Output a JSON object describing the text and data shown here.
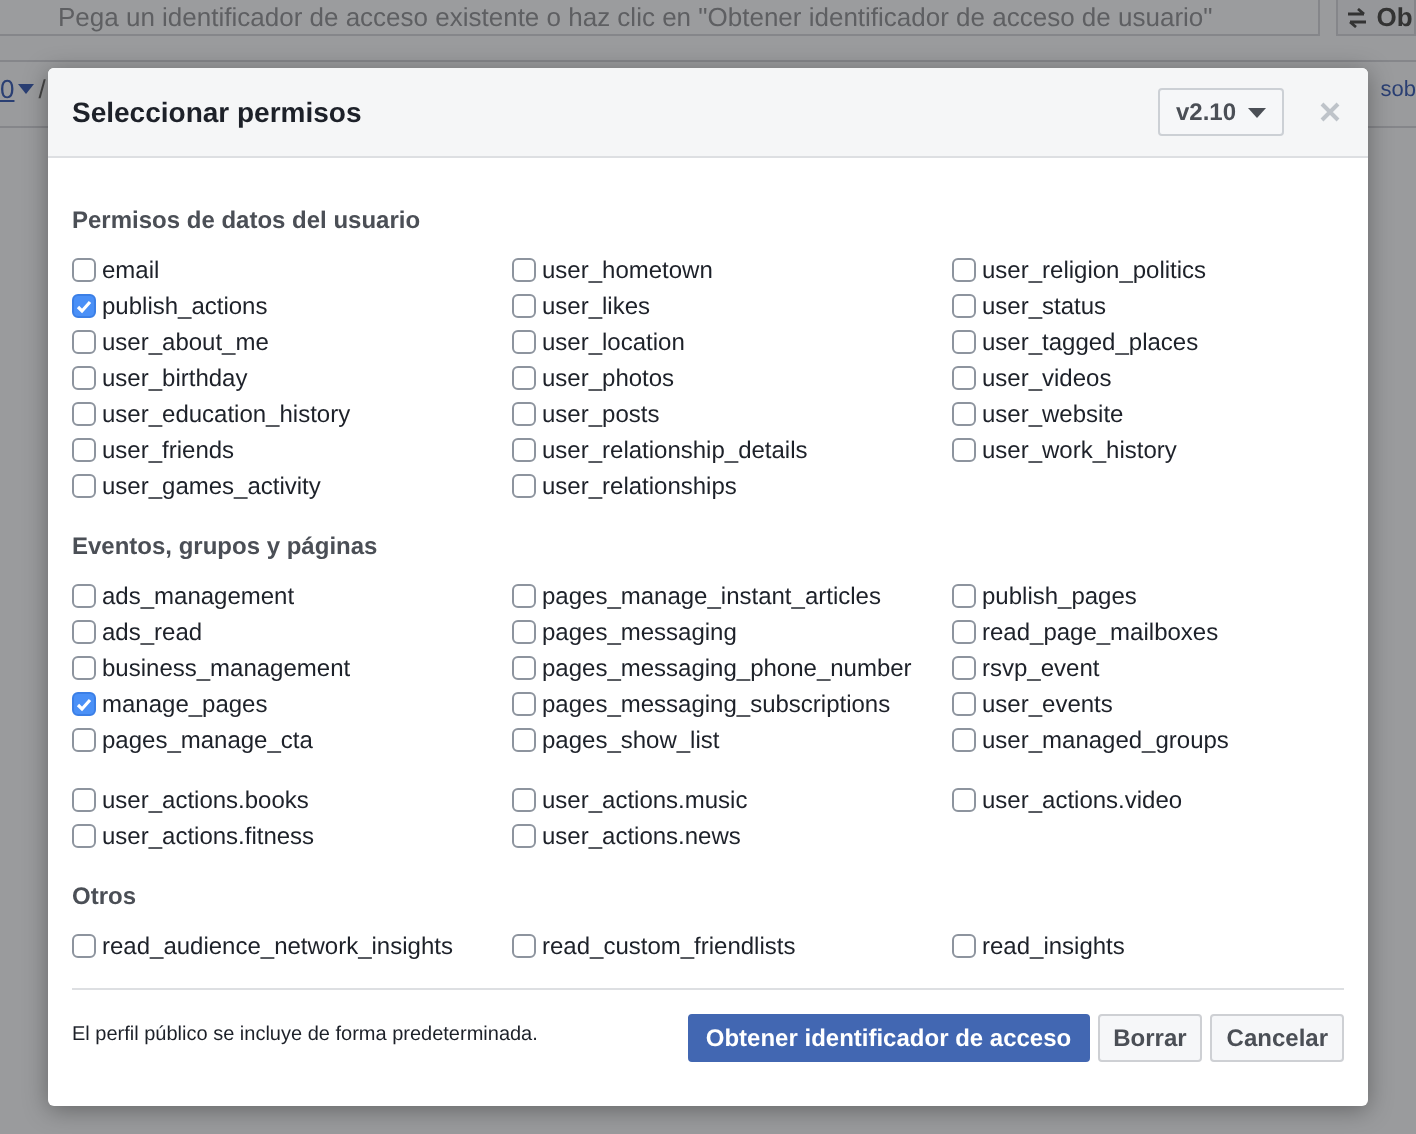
{
  "background": {
    "token_placeholder": "Pega un identificador de acceso existente o haz clic en \"Obtener identificador de acceso de usuario\"",
    "right_button": "Ob",
    "version_fragment": "0",
    "path_fragment": "/",
    "link_fragment": "sob"
  },
  "dialog": {
    "title": "Seleccionar permisos",
    "version": "v2.10",
    "sections": [
      {
        "title": "Permisos de datos del usuario",
        "groups": [
          {
            "columns": [
              [
                {
                  "label": "email",
                  "checked": false
                },
                {
                  "label": "publish_actions",
                  "checked": true
                },
                {
                  "label": "user_about_me",
                  "checked": false
                },
                {
                  "label": "user_birthday",
                  "checked": false
                },
                {
                  "label": "user_education_history",
                  "checked": false
                },
                {
                  "label": "user_friends",
                  "checked": false
                },
                {
                  "label": "user_games_activity",
                  "checked": false
                }
              ],
              [
                {
                  "label": "user_hometown",
                  "checked": false
                },
                {
                  "label": "user_likes",
                  "checked": false
                },
                {
                  "label": "user_location",
                  "checked": false
                },
                {
                  "label": "user_photos",
                  "checked": false
                },
                {
                  "label": "user_posts",
                  "checked": false
                },
                {
                  "label": "user_relationship_details",
                  "checked": false
                },
                {
                  "label": "user_relationships",
                  "checked": false
                }
              ],
              [
                {
                  "label": "user_religion_politics",
                  "checked": false
                },
                {
                  "label": "user_status",
                  "checked": false
                },
                {
                  "label": "user_tagged_places",
                  "checked": false
                },
                {
                  "label": "user_videos",
                  "checked": false
                },
                {
                  "label": "user_website",
                  "checked": false
                },
                {
                  "label": "user_work_history",
                  "checked": false
                }
              ]
            ]
          }
        ]
      },
      {
        "title": "Eventos, grupos y páginas",
        "groups": [
          {
            "columns": [
              [
                {
                  "label": "ads_management",
                  "checked": false
                },
                {
                  "label": "ads_read",
                  "checked": false
                },
                {
                  "label": "business_management",
                  "checked": false
                },
                {
                  "label": "manage_pages",
                  "checked": true
                },
                {
                  "label": "pages_manage_cta",
                  "checked": false
                }
              ],
              [
                {
                  "label": "pages_manage_instant_articles",
                  "checked": false
                },
                {
                  "label": "pages_messaging",
                  "checked": false
                },
                {
                  "label": "pages_messaging_phone_number",
                  "checked": false
                },
                {
                  "label": "pages_messaging_subscriptions",
                  "checked": false
                },
                {
                  "label": "pages_show_list",
                  "checked": false
                }
              ],
              [
                {
                  "label": "publish_pages",
                  "checked": false
                },
                {
                  "label": "read_page_mailboxes",
                  "checked": false
                },
                {
                  "label": "rsvp_event",
                  "checked": false
                },
                {
                  "label": "user_events",
                  "checked": false
                },
                {
                  "label": "user_managed_groups",
                  "checked": false
                }
              ]
            ]
          },
          {
            "columns": [
              [
                {
                  "label": "user_actions.books",
                  "checked": false
                },
                {
                  "label": "user_actions.fitness",
                  "checked": false
                }
              ],
              [
                {
                  "label": "user_actions.music",
                  "checked": false
                },
                {
                  "label": "user_actions.news",
                  "checked": false
                }
              ],
              [
                {
                  "label": "user_actions.video",
                  "checked": false
                }
              ]
            ]
          }
        ]
      },
      {
        "title": "Otros",
        "groups": [
          {
            "columns": [
              [
                {
                  "label": "read_audience_network_insights",
                  "checked": false
                }
              ],
              [
                {
                  "label": "read_custom_friendlists",
                  "checked": false
                }
              ],
              [
                {
                  "label": "read_insights",
                  "checked": false
                }
              ]
            ]
          }
        ]
      }
    ],
    "footer_note": "El perfil público se incluye de forma predeterminada.",
    "buttons": [
      {
        "label": "Obtener identificador de acceso",
        "kind": "primary"
      },
      {
        "label": "Borrar",
        "kind": "secondary"
      },
      {
        "label": "Cancelar",
        "kind": "secondary"
      }
    ]
  }
}
